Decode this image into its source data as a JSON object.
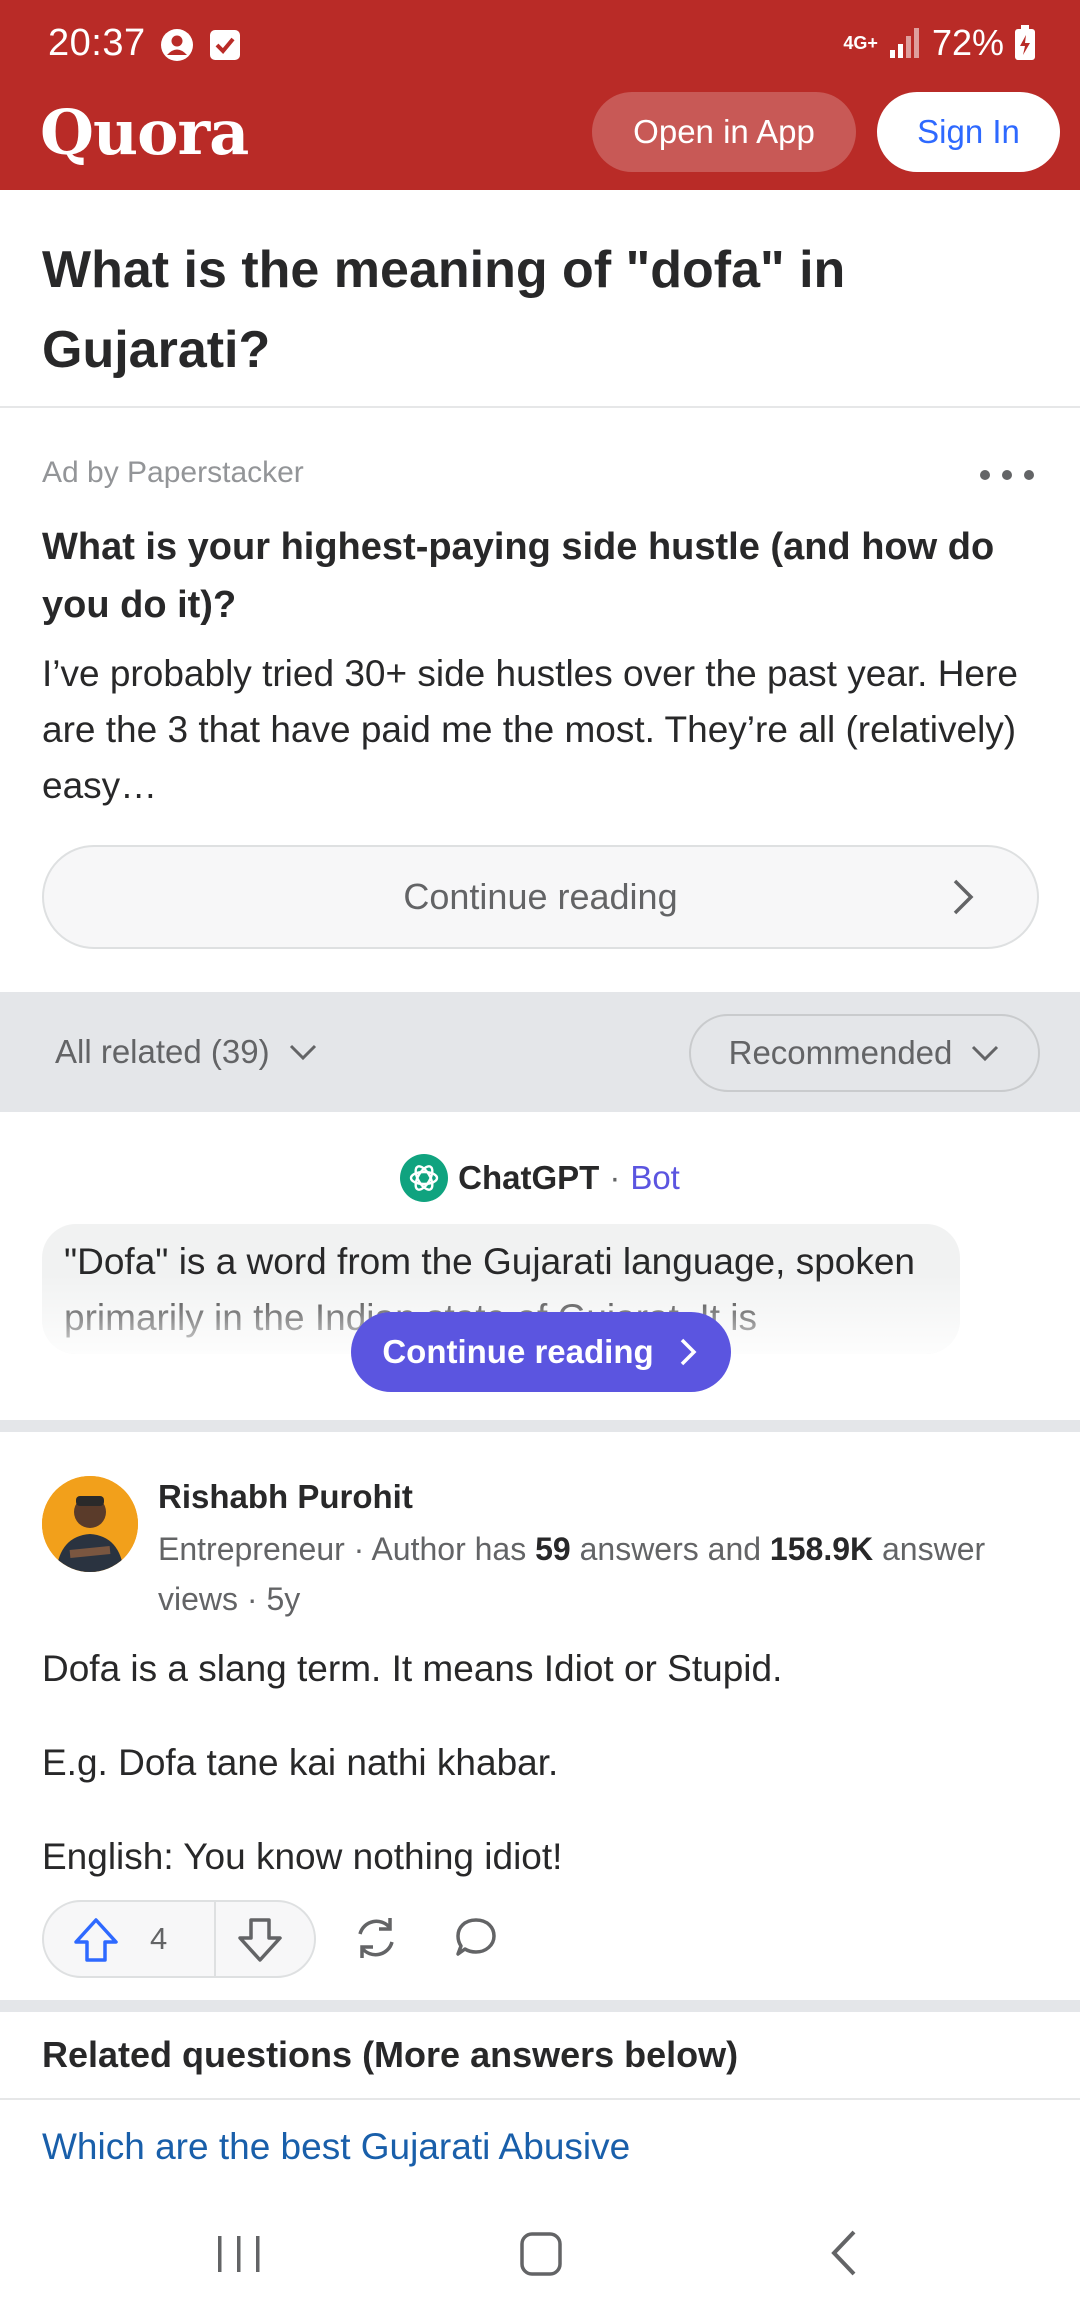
{
  "status_bar": {
    "time": "20:37",
    "network": "4G+",
    "battery": "72%"
  },
  "header": {
    "logo": "Quora",
    "open_in_app": "Open in App",
    "sign_in": "Sign In"
  },
  "question": {
    "title": "What is the meaning of \"dofa\" in Gujarati?"
  },
  "ad": {
    "sponsor": "Ad by Paperstacker",
    "title": "What is your highest-paying side hustle (and how do you do it)?",
    "body": "I’ve probably tried 30+ side hustles over the past year. Here are the 3 that have paid me the most. They’re all (relatively) easy…",
    "cta": "Continue reading"
  },
  "filters": {
    "related": "All related (39)",
    "sort": "Recommended"
  },
  "bot_answer": {
    "name": "ChatGPT",
    "separator": "·",
    "tag": "Bot",
    "text": "\"Dofa\" is a word from the Gujarati language, spoken primarily in the Indian state of Gujarat. It is",
    "cta": "Continue reading"
  },
  "answer": {
    "author": "Rishabh Purohit",
    "credential_prefix": "Entrepreneur · Author has ",
    "answers_count": "59",
    "credential_mid": " answers and ",
    "views_count": "158.9K",
    "credential_suffix": " answer views · 5y",
    "paragraphs": [
      "Dofa is a slang term. It means Idiot or Stupid.",
      "E.g. Dofa tane kai nathi khabar.",
      "English: You know nothing idiot!"
    ],
    "upvotes": "4"
  },
  "related": {
    "heading": "Related questions (More answers below)",
    "first_link": "Which are the best Gujarati Abusive"
  },
  "colors": {
    "brand": "#b92b27",
    "link": "#195faa",
    "bot_accent": "#5b55e0"
  }
}
